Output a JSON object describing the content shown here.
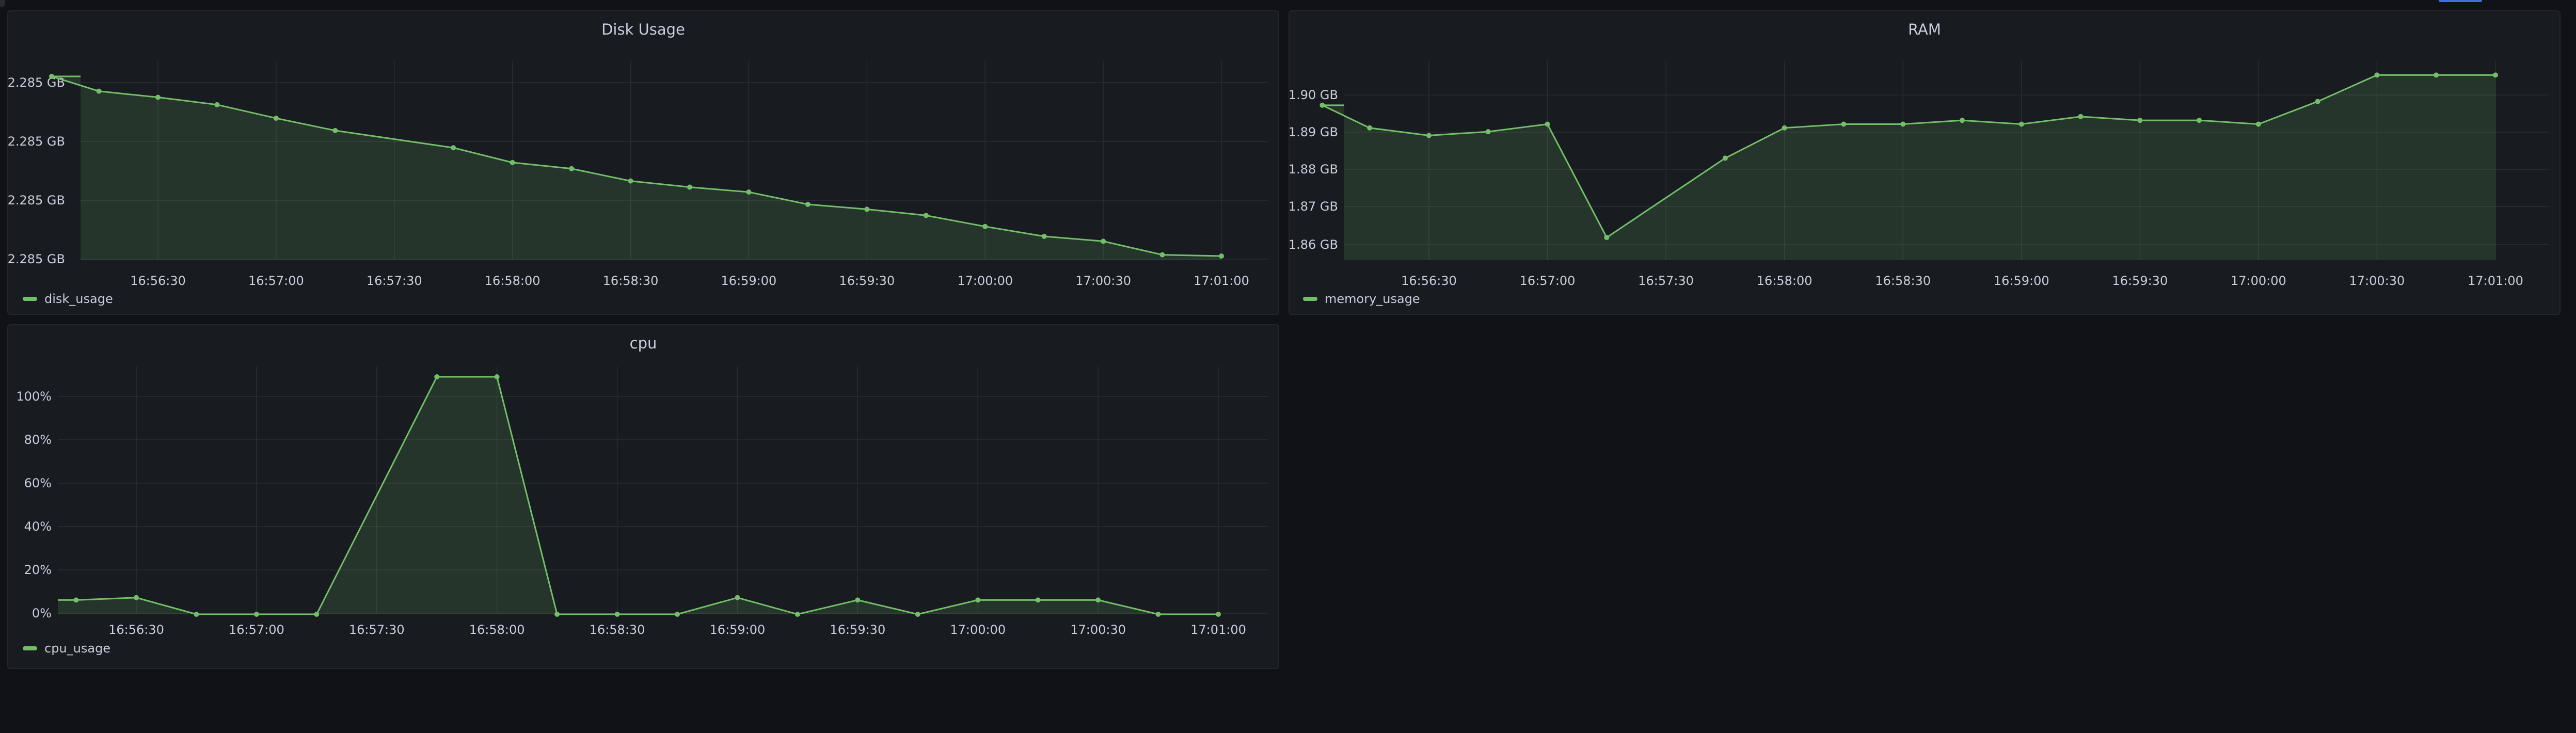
{
  "panels": {
    "disk": {
      "title": "Disk Usage",
      "legend": "disk_usage"
    },
    "ram": {
      "title": "RAM",
      "legend": "memory_usage"
    },
    "cpu": {
      "title": "cpu",
      "legend": "cpu_usage"
    }
  },
  "colors": {
    "series": "#73bf69",
    "background": "#111217",
    "panel": "#181b1f",
    "grid": "#2b2d33",
    "text": "#ccccdc"
  },
  "chart_data": [
    {
      "id": "disk",
      "type": "area",
      "title": "Disk Usage",
      "x_ticks": [
        "16:56:30",
        "16:57:00",
        "16:57:30",
        "16:58:00",
        "16:58:30",
        "16:59:00",
        "16:59:30",
        "17:00:00",
        "17:00:30",
        "17:01:00"
      ],
      "y_ticks": [
        "2.285 GB",
        "2.285 GB",
        "2.285 GB",
        "2.285 GB"
      ],
      "ylim": [
        0,
        1
      ],
      "series": [
        {
          "name": "disk_usage",
          "x": [
            "16:56:03",
            "16:56:15",
            "16:56:30",
            "16:56:45",
            "16:57:00",
            "16:57:15",
            "16:57:45",
            "16:58:00",
            "16:58:15",
            "16:58:30",
            "16:58:45",
            "16:59:00",
            "16:59:15",
            "16:59:30",
            "16:59:45",
            "17:00:00",
            "17:00:15",
            "17:00:30",
            "17:00:45",
            "17:01:00"
          ],
          "values": [
            0.94,
            0.82,
            0.77,
            0.71,
            0.6,
            0.5,
            0.36,
            0.24,
            0.19,
            0.09,
            0.04,
            0.0,
            -0.1,
            -0.14,
            -0.19,
            -0.28,
            -0.36,
            -0.4,
            -0.51,
            -0.52
          ]
        }
      ]
    },
    {
      "id": "ram",
      "type": "area",
      "title": "RAM",
      "x_ticks": [
        "16:56:30",
        "16:57:00",
        "16:57:30",
        "16:58:00",
        "16:58:30",
        "16:59:00",
        "16:59:30",
        "17:00:00",
        "17:00:30",
        "17:01:00"
      ],
      "y_ticks": [
        "1.90 GB",
        "1.89 GB",
        "1.88 GB",
        "1.87 GB",
        "1.86 GB"
      ],
      "ylim": [
        1.855,
        1.905
      ],
      "series": [
        {
          "name": "memory_usage",
          "x": [
            "16:56:03",
            "16:56:15",
            "16:56:30",
            "16:56:45",
            "16:57:00",
            "16:57:15",
            "16:57:45",
            "16:58:00",
            "16:58:15",
            "16:58:30",
            "16:58:45",
            "16:59:00",
            "16:59:15",
            "16:59:30",
            "16:59:45",
            "17:00:00",
            "17:00:15",
            "17:00:30",
            "17:00:45",
            "17:01:00"
          ],
          "values": [
            1.896,
            1.89,
            1.888,
            1.889,
            1.891,
            1.861,
            1.882,
            1.89,
            1.891,
            1.891,
            1.892,
            1.891,
            1.893,
            1.892,
            1.892,
            1.891,
            1.897,
            1.904,
            1.904,
            1.904
          ]
        }
      ]
    },
    {
      "id": "cpu",
      "type": "area",
      "title": "cpu",
      "x_ticks": [
        "16:56:30",
        "16:57:00",
        "16:57:30",
        "16:58:00",
        "16:58:30",
        "16:59:00",
        "16:59:30",
        "17:00:00",
        "17:00:30",
        "17:01:00"
      ],
      "y_ticks": [
        "100%",
        "80%",
        "60%",
        "40%",
        "20%",
        "0%"
      ],
      "ylim": [
        0,
        100
      ],
      "series": [
        {
          "name": "cpu_usage",
          "x": [
            "16:56:15",
            "16:56:30",
            "16:56:45",
            "16:57:00",
            "16:57:15",
            "16:57:45",
            "16:58:00",
            "16:58:15",
            "16:58:30",
            "16:58:45",
            "16:59:00",
            "16:59:15",
            "16:59:30",
            "16:59:45",
            "17:00:00",
            "17:00:15",
            "17:00:30",
            "17:00:45",
            "17:01:00"
          ],
          "values": [
            6,
            7,
            0,
            0,
            0,
            100,
            100,
            0,
            0,
            0,
            7,
            0,
            6,
            0,
            6,
            6,
            6,
            0,
            0
          ]
        }
      ]
    }
  ]
}
